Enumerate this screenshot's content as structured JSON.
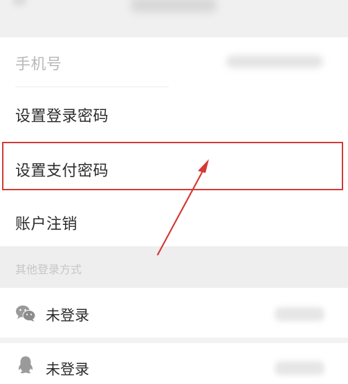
{
  "account_rows": [
    {
      "label": "手机号"
    },
    {
      "label": "设置登录密码"
    },
    {
      "label": "设置支付密码"
    },
    {
      "label": "账户注销"
    }
  ],
  "section_header": "其他登录方式",
  "login_methods": [
    {
      "icon": "wechat-icon",
      "status": "未登录"
    },
    {
      "icon": "qq-icon",
      "status": "未登录"
    }
  ],
  "colors": {
    "highlight": "#d33a35",
    "arrow": "#d33a35"
  }
}
